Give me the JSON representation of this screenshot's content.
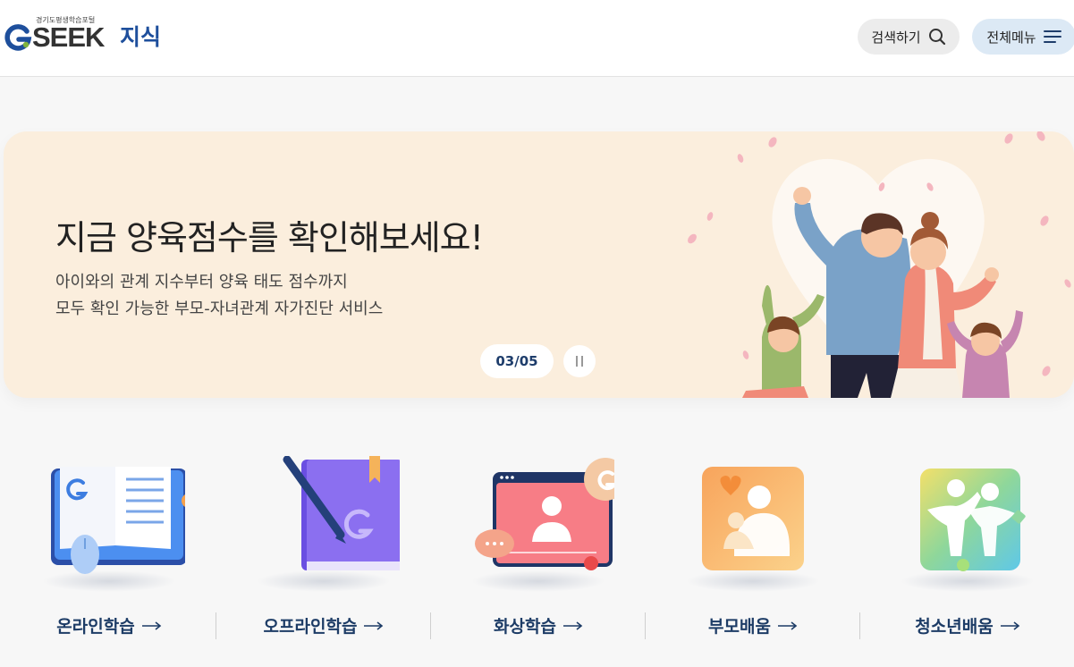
{
  "header": {
    "logo_sub": "경기도평생학습포털",
    "logo_brand": "SEEK",
    "logo_name": "지식",
    "search_label": "검색하기",
    "menu_label": "전체메뉴"
  },
  "banner": {
    "title": "지금 양육점수를 확인해보세요!",
    "desc_line1": "아이와의 관계 지수부터 양육 태도 점수까지",
    "desc_line2": "모두 확인 가능한 부모-자녀관계 자가진단 서비스",
    "pager": "03/05"
  },
  "quick_menu": [
    {
      "label": "온라인학습",
      "icon": "online-learning-icon"
    },
    {
      "label": "오프라인학습",
      "icon": "offline-learning-icon"
    },
    {
      "label": "화상학습",
      "icon": "video-learning-icon"
    },
    {
      "label": "부모배움",
      "icon": "parent-learning-icon"
    },
    {
      "label": "청소년배움",
      "icon": "youth-learning-icon"
    }
  ],
  "colors": {
    "brand_blue": "#1e4f9c",
    "banner_bg": "#fbeedd",
    "label_navy": "#1d3c66"
  }
}
